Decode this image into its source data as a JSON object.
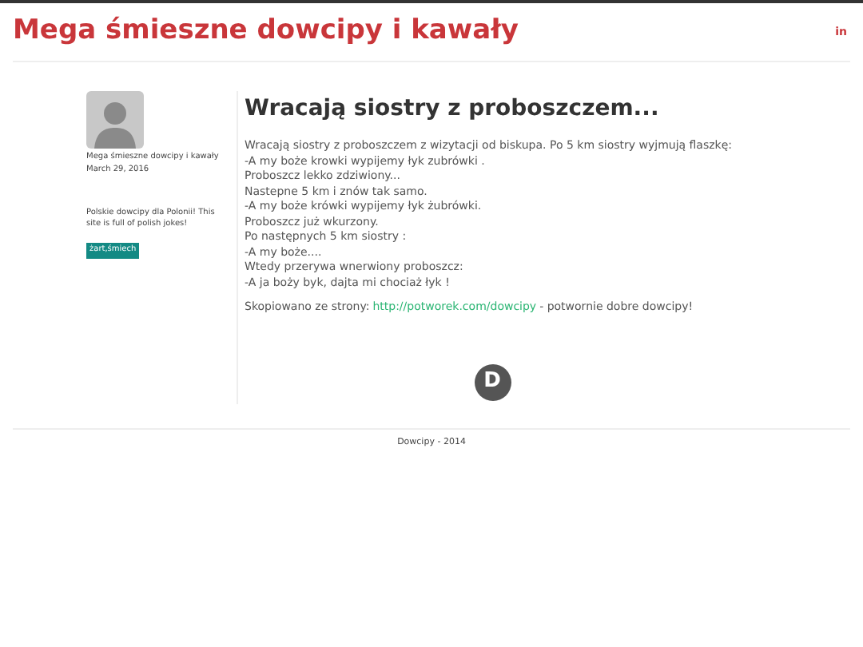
{
  "site_title": "Mega śmieszne dowcipy i kawały",
  "social_link": "in",
  "author": {
    "name": "Mega śmieszne dowcipy i kawały",
    "date": "March 29, 2016",
    "bio": "Polskie dowcipy dla Polonii! This site is full of polish jokes!",
    "tag": "żart,śmiech"
  },
  "post": {
    "title": "Wracają siostry z proboszczem...",
    "lines": [
      "Wracają siostry z proboszczem z wizytacji od biskupa. Po 5 km siostry wyjmują flaszkę:",
      "-A my boże krowki wypijemy łyk zubrówki .",
      "Proboszcz lekko zdziwiony...",
      "Nastepne 5 km i znów tak samo.",
      "-A my boże krówki wypijemy łyk żubrówki.",
      "Proboszcz już wkurzony.",
      "Po następnych 5 km siostry :",
      "-A my boże....",
      "Wtedy przerywa wnerwiony proboszcz:",
      "-A ja boży byk, dajta mi chociaż łyk !"
    ],
    "source_label": "Skopiowano ze strony:",
    "source_link": "http://potworek.com/dowcipy",
    "source_suffix": "- potwornie dobre dowcipy!"
  },
  "comments_logo": "D",
  "footer": "Dowcipy - 2014"
}
